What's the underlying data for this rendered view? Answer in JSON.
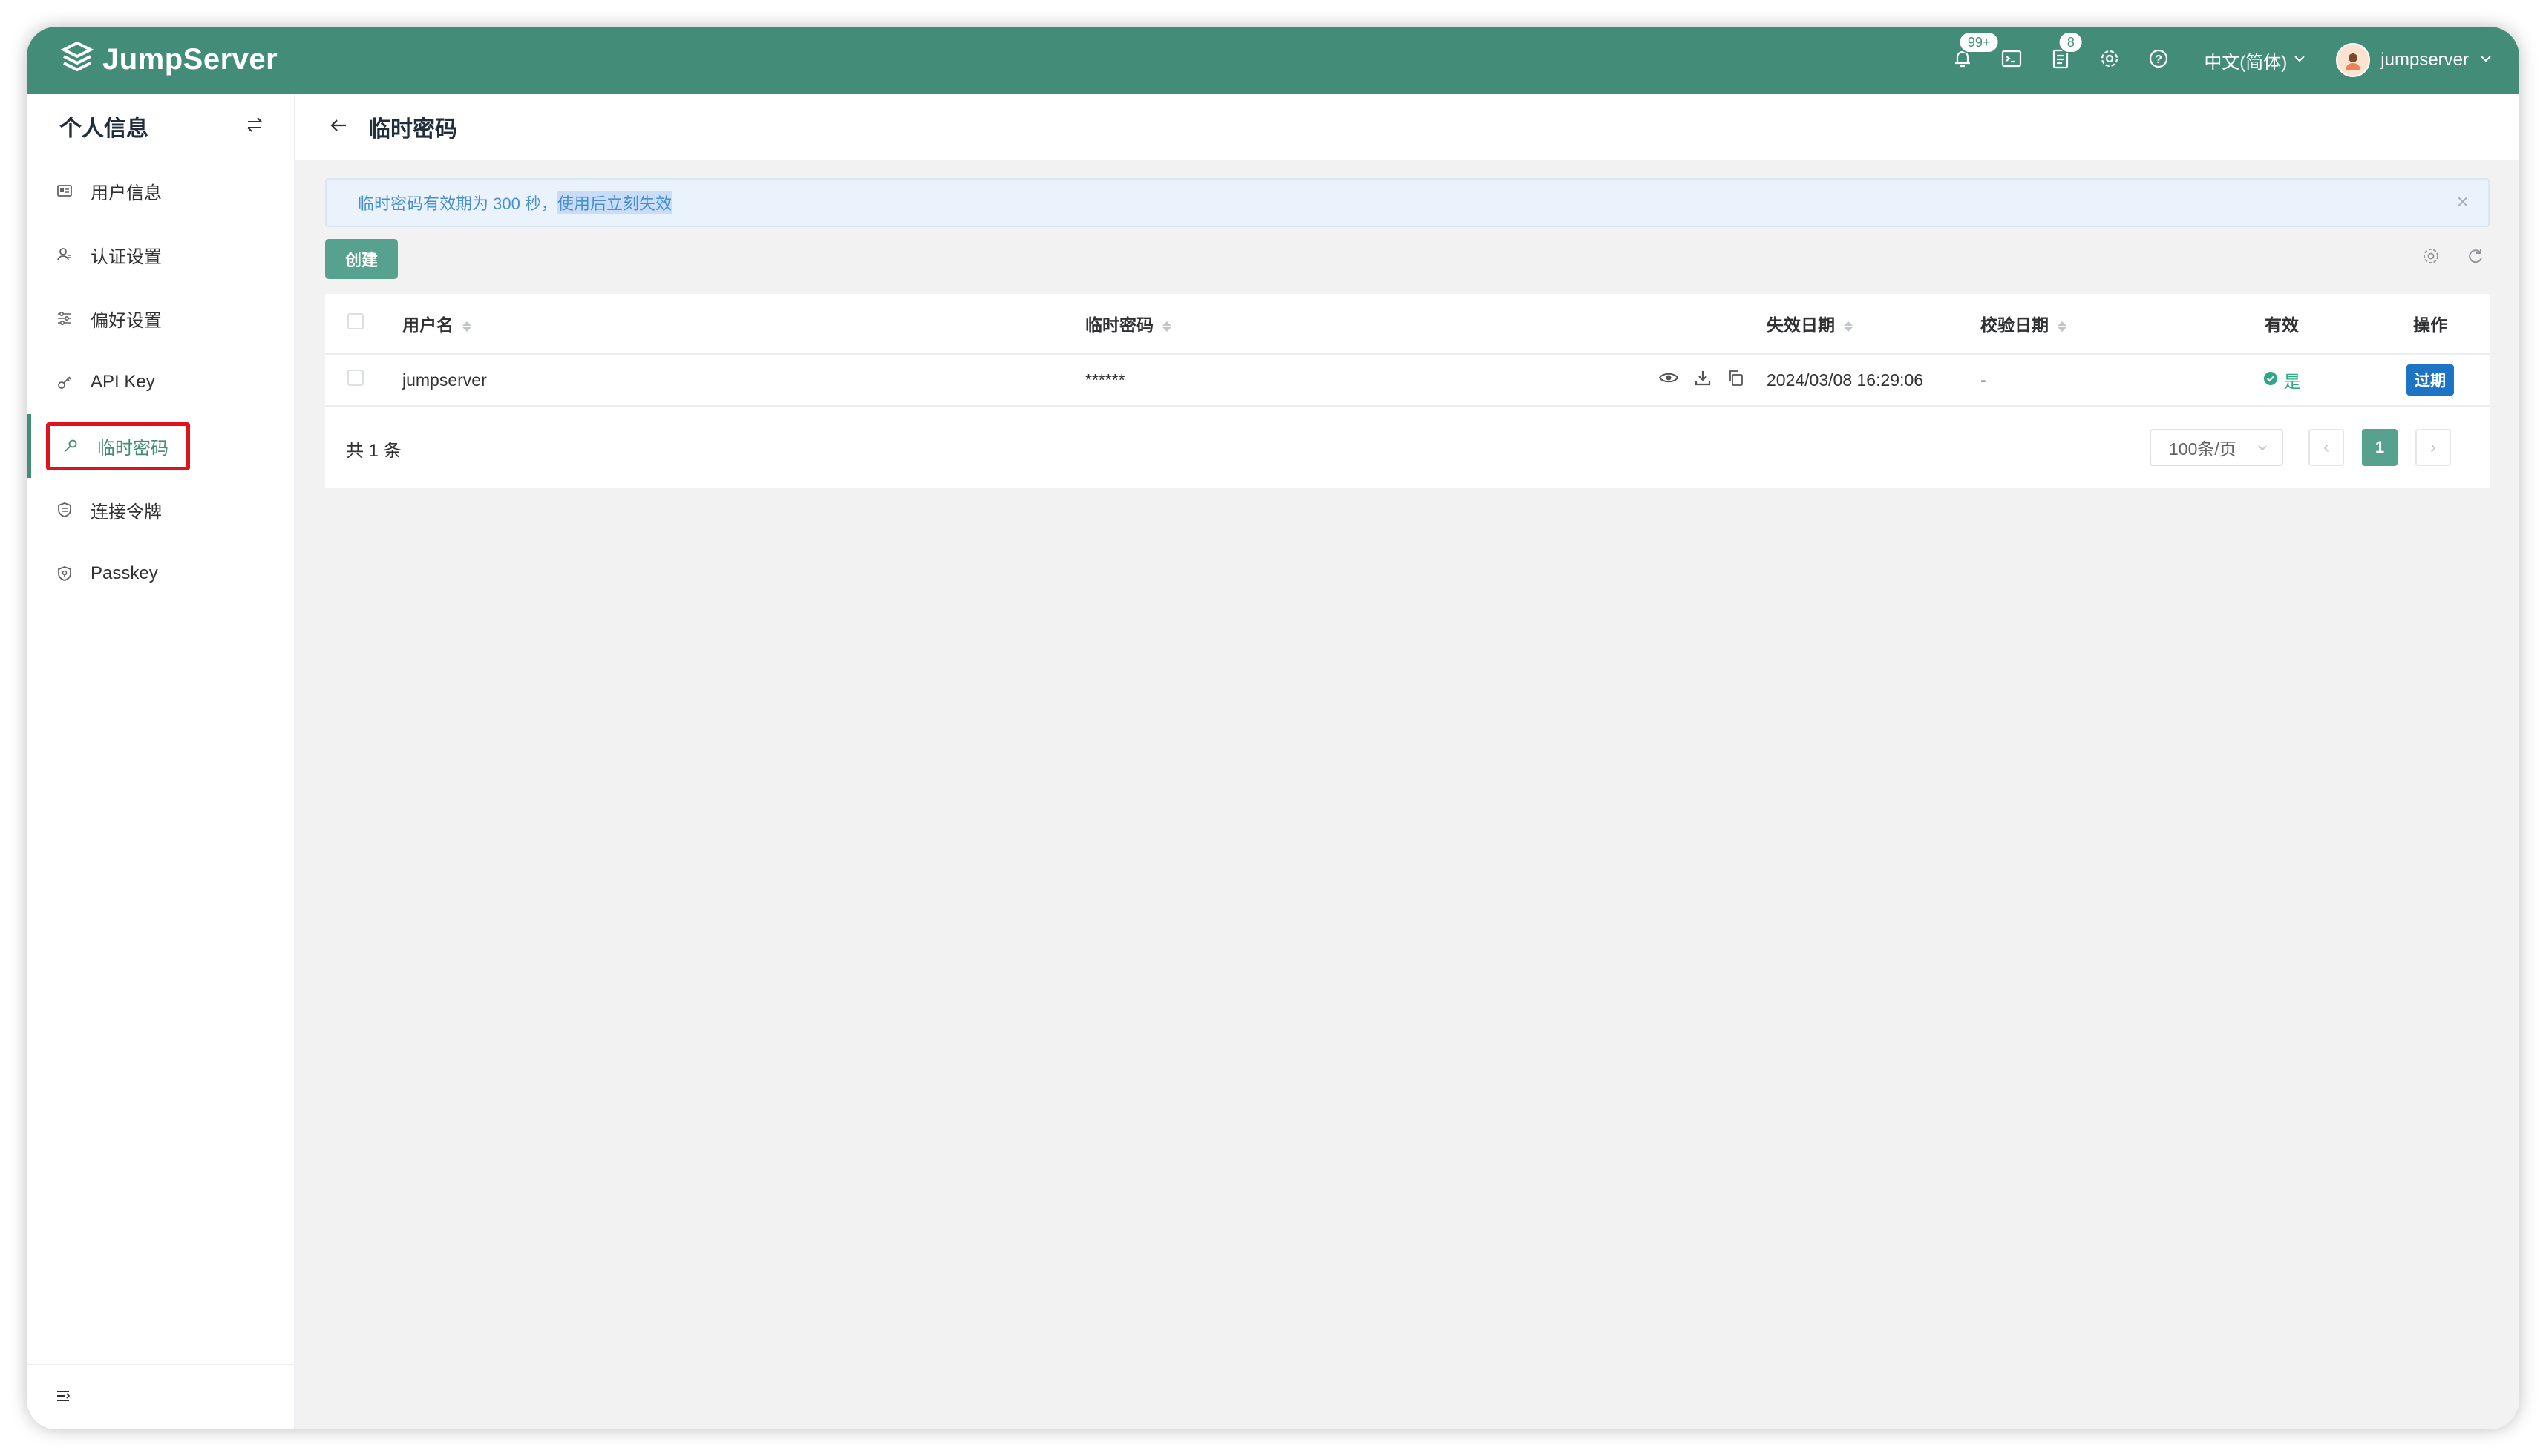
{
  "header": {
    "brand": "JumpServer",
    "notification_badge": "99+",
    "ticket_badge": "8",
    "language": "中文(简体)",
    "username": "jumpserver"
  },
  "sidebar": {
    "title": "个人信息",
    "items": [
      {
        "label": "用户信息",
        "icon": "id-card-icon"
      },
      {
        "label": "认证设置",
        "icon": "user-shield-icon"
      },
      {
        "label": "偏好设置",
        "icon": "sliders-icon"
      },
      {
        "label": "API Key",
        "icon": "key-icon"
      },
      {
        "label": "临时密码",
        "icon": "pin-key-icon",
        "active": true
      },
      {
        "label": "连接令牌",
        "icon": "token-shield-icon"
      },
      {
        "label": "Passkey",
        "icon": "passkey-shield-icon"
      }
    ]
  },
  "page": {
    "title": "临时密码",
    "alert_text": "临时密码有效期为 300 秒，",
    "alert_highlight": "使用后立刻失效",
    "create_label": "创建"
  },
  "table": {
    "headers": {
      "username": "用户名",
      "password": "临时密码",
      "expire_date": "失效日期",
      "verify_date": "校验日期",
      "valid": "有效",
      "actions": "操作"
    },
    "rows": [
      {
        "username": "jumpserver",
        "password": "******",
        "expire_date": "2024/03/08 16:29:06",
        "verify_date": "-",
        "valid": "是",
        "action": "过期"
      }
    ],
    "total": "共 1 条",
    "page_size": "100条/页",
    "current_page": "1"
  },
  "colors": {
    "brand": "#428c78",
    "accent": "#56a28e",
    "expire_button": "#1d74c5",
    "highlight_box": "#e0121b"
  }
}
